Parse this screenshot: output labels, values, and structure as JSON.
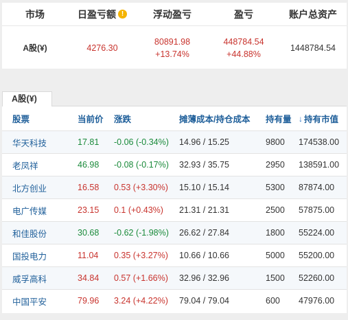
{
  "summary": {
    "headers": {
      "market": "市场",
      "daily_pl": "日盈亏额",
      "floating_pl": "浮动盈亏",
      "pl": "盈亏",
      "total_assets": "账户总资产"
    },
    "info_glyph": "!",
    "row": {
      "market": "A股(¥)",
      "daily_pl": "4276.30",
      "floating_pl_value": "80891.98",
      "floating_pl_pct": "+13.74%",
      "pl_value": "448784.54",
      "pl_pct": "+44.88%",
      "total_assets": "1448784.54"
    }
  },
  "holdings": {
    "tab_label": "A股(¥)",
    "columns": {
      "stock": "股票",
      "price": "当前价",
      "change": "涨跌",
      "cost": "摊薄成本/持仓成本",
      "shares": "持有量",
      "market_value": "持有市值"
    },
    "sort_icon": "down-arrow-icon",
    "rows": [
      {
        "name": "华天科技",
        "price": "17.81",
        "change": "-0.06 (-0.34%)",
        "direction": "down",
        "cost": "14.96 / 15.25",
        "shares": "9800",
        "value": "174538.00"
      },
      {
        "name": "老凤祥",
        "price": "46.98",
        "change": "-0.08 (-0.17%)",
        "direction": "down",
        "cost": "32.93 / 35.75",
        "shares": "2950",
        "value": "138591.00"
      },
      {
        "name": "北方创业",
        "price": "16.58",
        "change": "0.53 (+3.30%)",
        "direction": "up",
        "cost": "15.10 / 15.14",
        "shares": "5300",
        "value": "87874.00"
      },
      {
        "name": "电广传媒",
        "price": "23.15",
        "change": "0.1 (+0.43%)",
        "direction": "up",
        "cost": "21.31 / 21.31",
        "shares": "2500",
        "value": "57875.00"
      },
      {
        "name": "和佳股份",
        "price": "30.68",
        "change": "-0.62 (-1.98%)",
        "direction": "down",
        "cost": "26.62 / 27.84",
        "shares": "1800",
        "value": "55224.00"
      },
      {
        "name": "国投电力",
        "price": "11.04",
        "change": "0.35 (+3.27%)",
        "direction": "up",
        "cost": "10.66 / 10.66",
        "shares": "5000",
        "value": "55200.00"
      },
      {
        "name": "威孚高科",
        "price": "34.84",
        "change": "0.57 (+1.66%)",
        "direction": "up",
        "cost": "32.96 / 32.96",
        "shares": "1500",
        "value": "52260.00"
      },
      {
        "name": "中国平安",
        "price": "79.96",
        "change": "3.24 (+4.22%)",
        "direction": "up",
        "cost": "79.04 / 79.04",
        "shares": "600",
        "value": "47976.00"
      }
    ]
  },
  "colors": {
    "up": "#c8332d",
    "down": "#1a8a3a",
    "link": "#1f5f9a"
  }
}
